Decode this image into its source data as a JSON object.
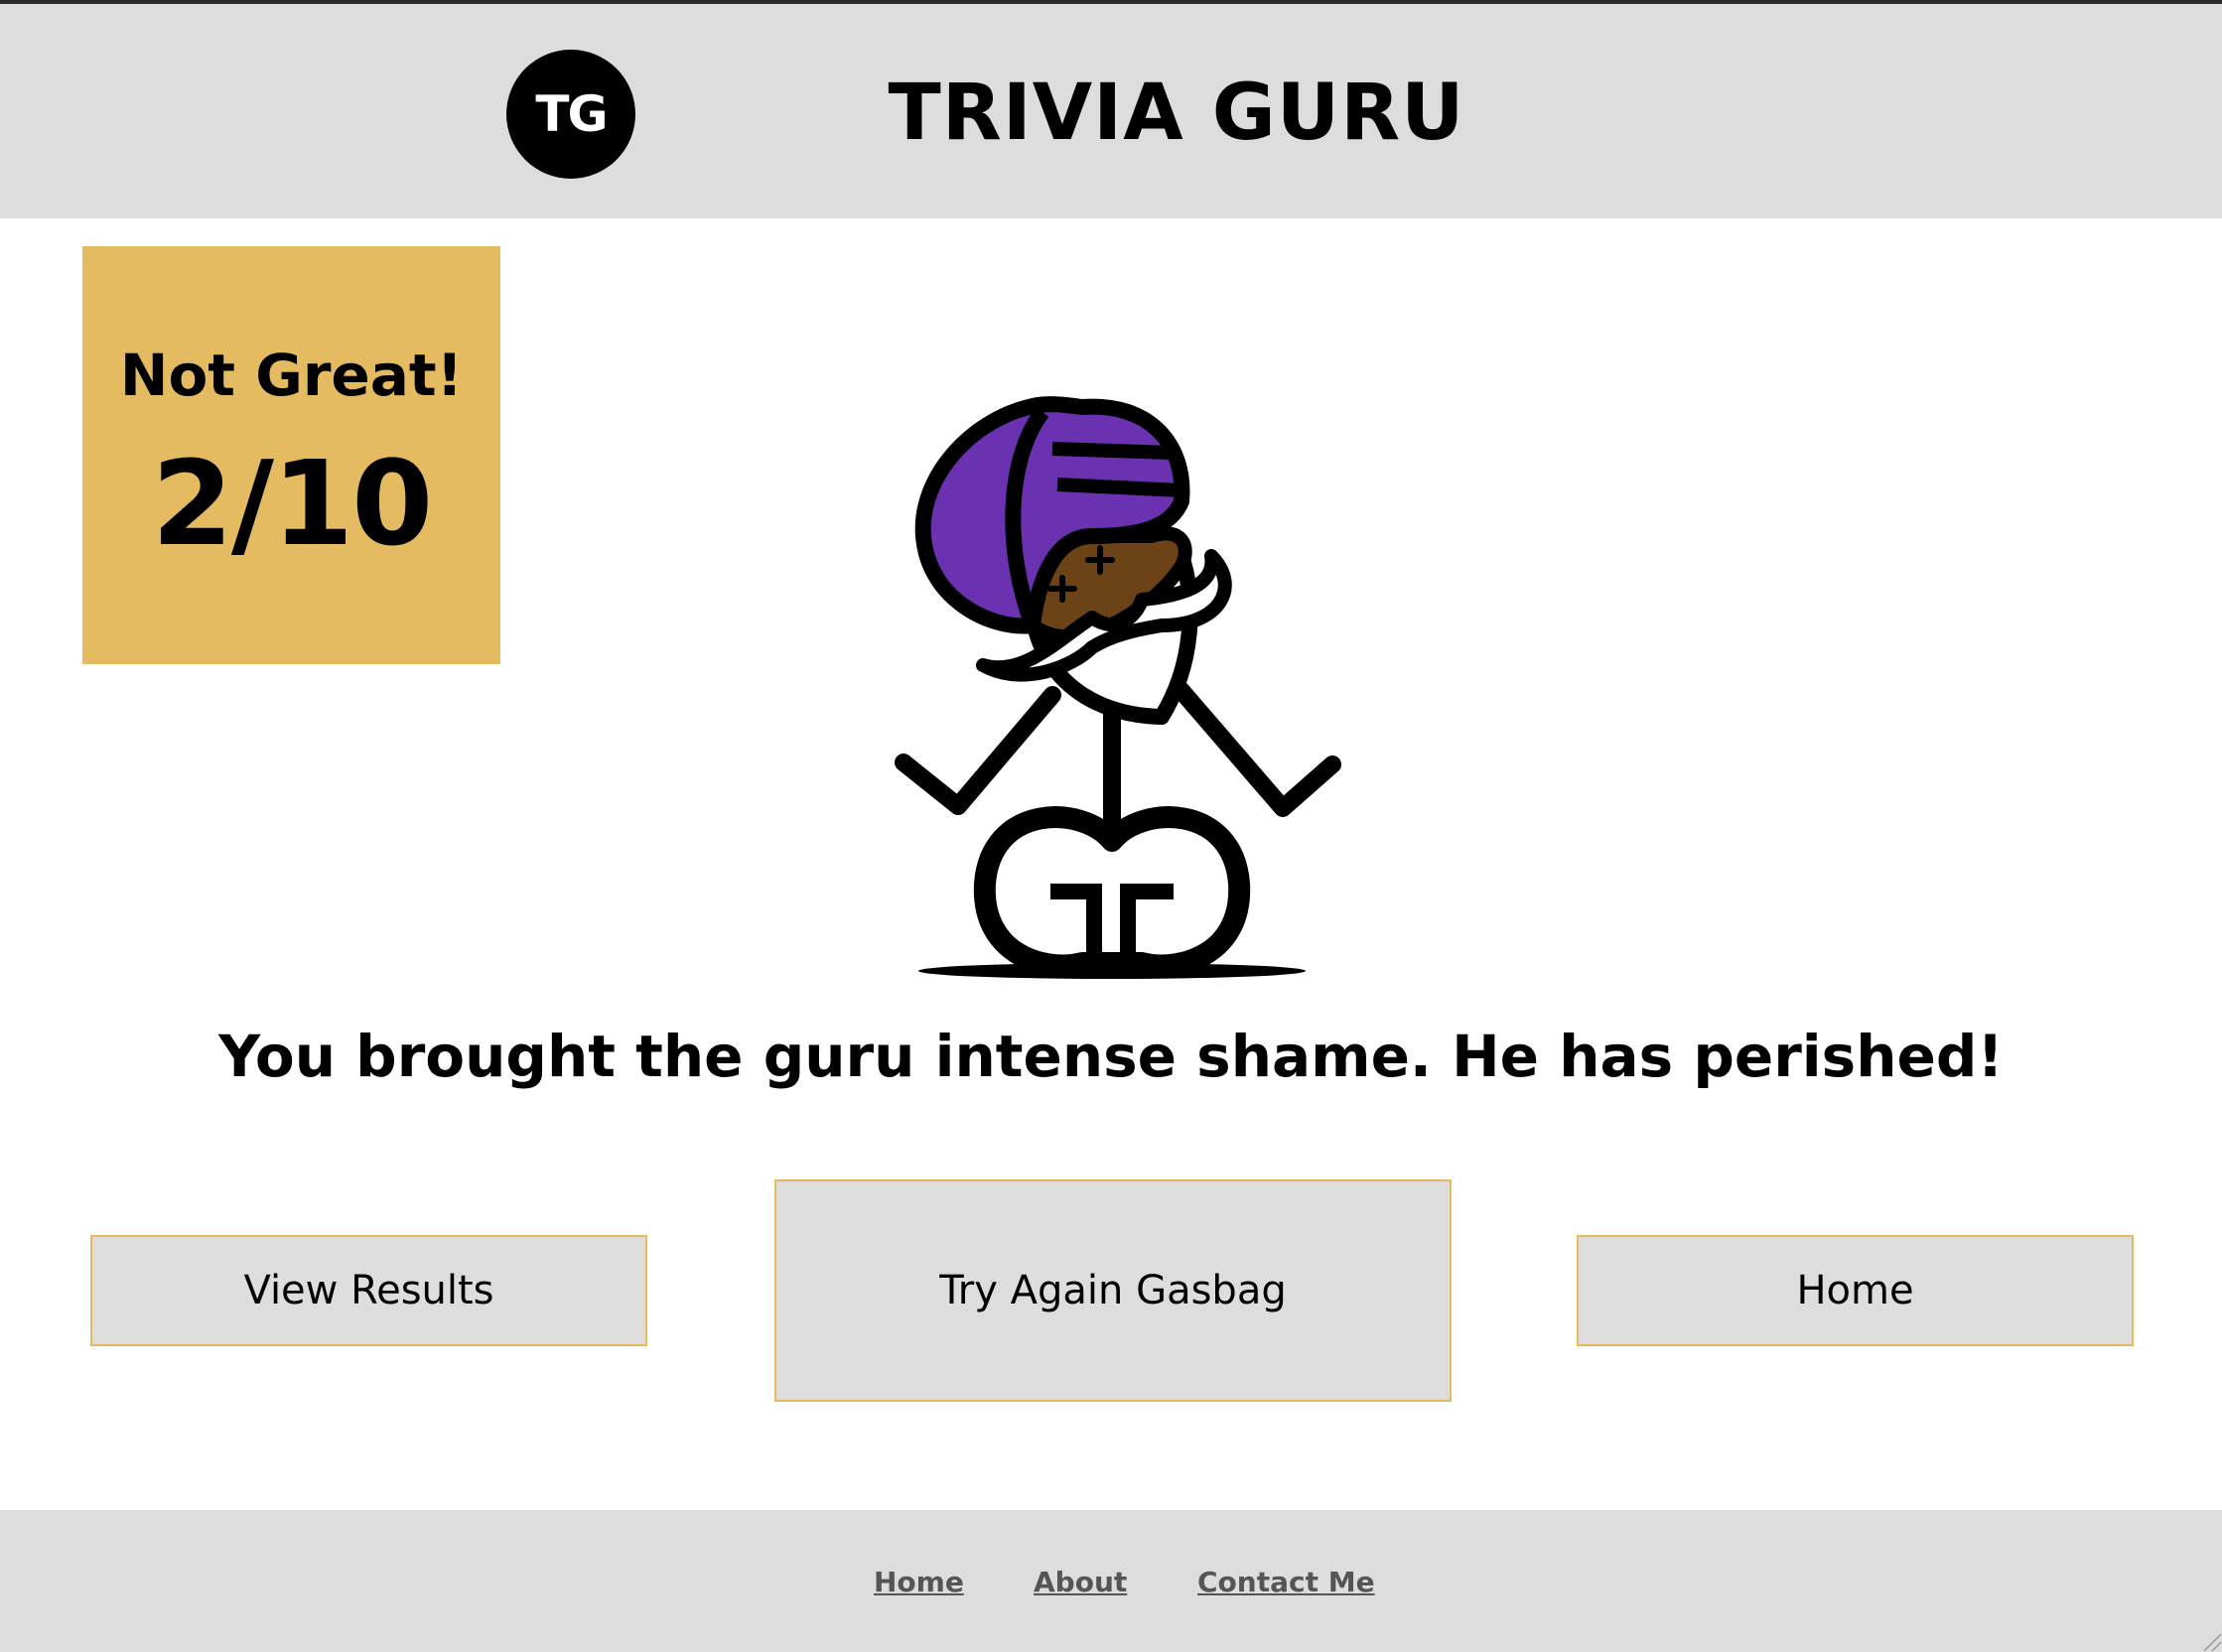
{
  "header": {
    "logo_text": "TG",
    "title": "TRIVIA GURU"
  },
  "score": {
    "label": "Not Great!",
    "value": "2/10",
    "box_color": "#e4bb60"
  },
  "illustration": {
    "icon": "dead-guru-icon",
    "turban_color": "#6a32b0",
    "face_color": "#6b4316"
  },
  "message": "You brought the guru intense shame. He has perished!",
  "buttons": {
    "view_results": "View Results",
    "try_again": "Try Again Gasbag",
    "home": "Home"
  },
  "footer": {
    "links": [
      "Home",
      "About",
      "Contact Me"
    ]
  }
}
